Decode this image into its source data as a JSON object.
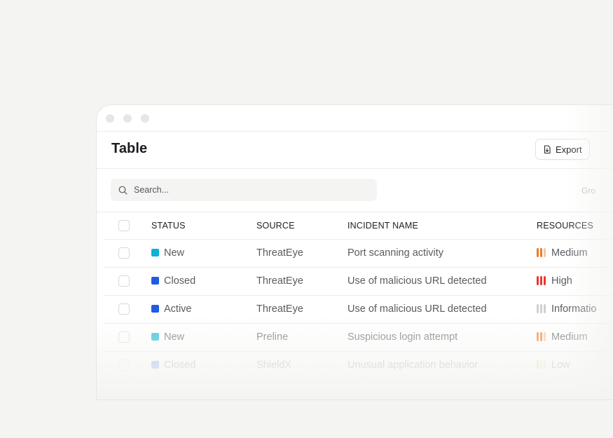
{
  "window": {
    "controls": [
      "dot",
      "dot",
      "dot"
    ]
  },
  "header": {
    "title": "Table",
    "export_label": "Export",
    "export_icon": "file-export-icon"
  },
  "toolbar": {
    "search_placeholder": "Search...",
    "search_icon": "search-icon",
    "group_label": "Gro"
  },
  "table": {
    "columns": [
      "STATUS",
      "SOURCE",
      "INCIDENT NAME",
      "RESOURCES"
    ],
    "rows": [
      {
        "status": "New",
        "status_color": "#0bb2d4",
        "source": "ThreatEye",
        "name": "Port scanning activity",
        "resource": "Medium",
        "bar_colors": [
          "#f07a25",
          "#f07a25",
          "#f3c7a6"
        ]
      },
      {
        "status": "Closed",
        "status_color": "#1e5be6",
        "source": "ThreatEye",
        "name": "Use of malicious URL detected",
        "resource": "High",
        "bar_colors": [
          "#e5392f",
          "#e5392f",
          "#e5392f"
        ]
      },
      {
        "status": "Active",
        "status_color": "#1e5be6",
        "source": "ThreatEye",
        "name": "Use of malicious URL detected",
        "resource": "Informatio",
        "bar_colors": [
          "#cfcfcf",
          "#cfcfcf",
          "#cfcfcf"
        ]
      },
      {
        "status": "New",
        "status_color": "#0bb2d4",
        "source": "Preline",
        "name": "Suspicious login attempt",
        "resource": "Medium",
        "bar_colors": [
          "#f07a25",
          "#f07a25",
          "#f3c7a6"
        ]
      },
      {
        "status": "Closed",
        "status_color": "#1e5be6",
        "source": "ShieldX",
        "name": "Unusual application behavior",
        "resource": "Low",
        "bar_colors": [
          "#f0c232",
          "#f3dca0",
          "#f3dca0"
        ]
      }
    ]
  }
}
